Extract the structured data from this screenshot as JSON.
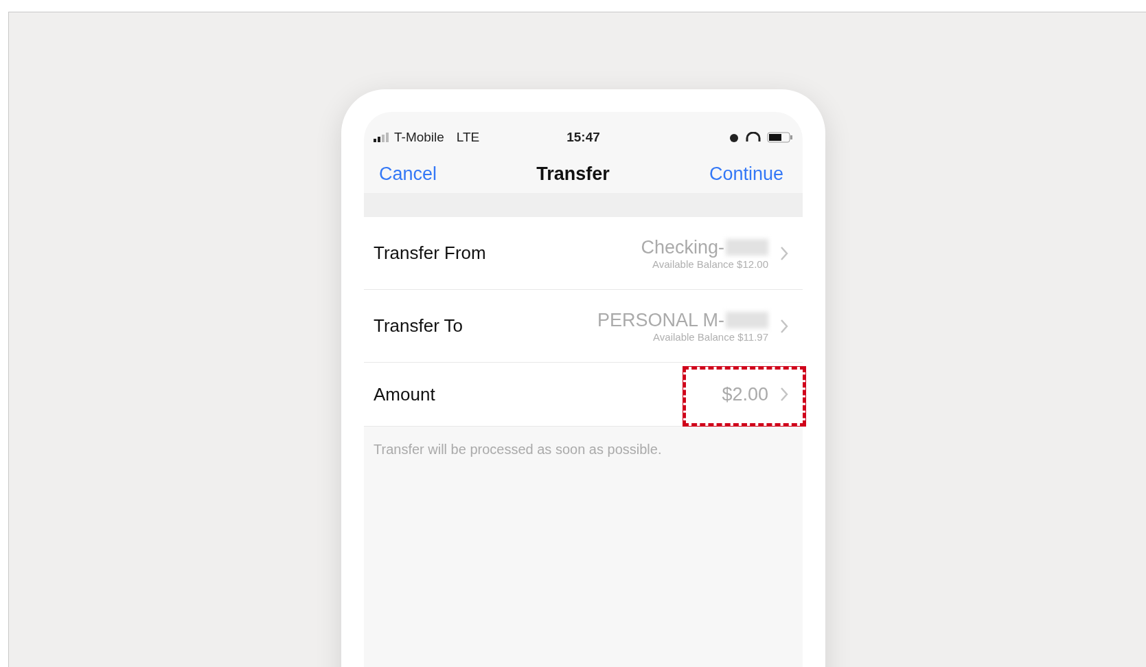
{
  "status_bar": {
    "carrier": "T-Mobile",
    "network": "LTE",
    "time": "15:47"
  },
  "nav": {
    "cancel": "Cancel",
    "title": "Transfer",
    "continue": "Continue"
  },
  "rows": [
    {
      "kind": "account",
      "label": "Transfer From",
      "account": "Checking-",
      "masked": true,
      "balance": "Available Balance $12.00",
      "highlighted": false
    },
    {
      "kind": "account",
      "label": "Transfer To",
      "account": "PERSONAL M-",
      "masked": true,
      "balance": "Available Balance $11.97",
      "highlighted": false
    },
    {
      "kind": "amount",
      "label": "Amount",
      "value": "$2.00",
      "highlighted": true
    }
  ],
  "footer_note": "Transfer will be processed as soon as possible."
}
